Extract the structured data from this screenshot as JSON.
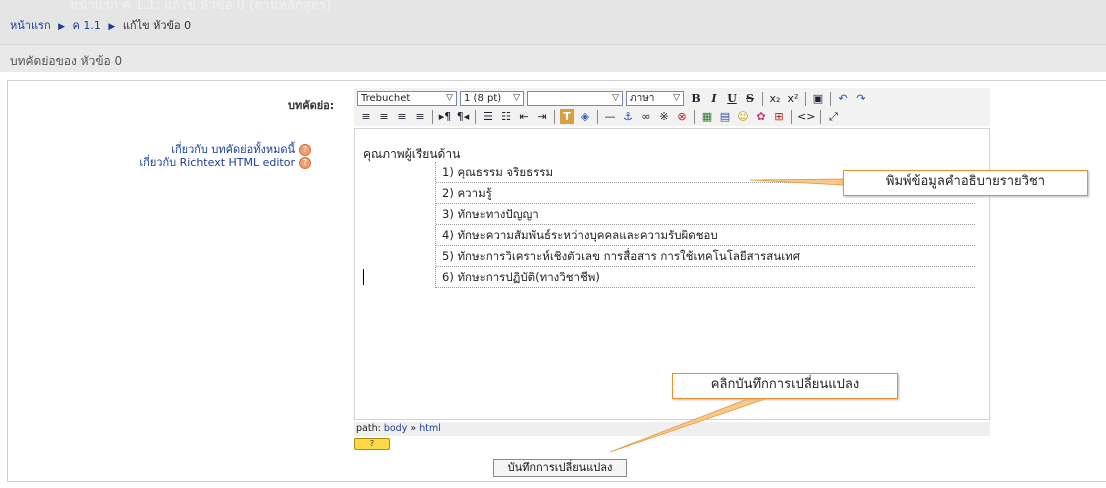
{
  "header": {
    "faded_title": "หน้าแรก ค 1.1: แก้ไข หัวข้อ 0 (ตามหลักสูตร)",
    "breadcrumb": {
      "home": "หน้าแรก",
      "course": "ค 1.1",
      "current": "แก้ไข หัวข้อ 0",
      "separator": "▶"
    }
  },
  "section_heading": "บทคัดย่อของ หัวข้อ 0",
  "form": {
    "summary_label": "บทคัดย่อ:",
    "help_links": {
      "about_summary": "เกี่ยวกับ บทคัดย่อทั้งหมดนี้",
      "about_editor": "เกี่ยวกับ Richtext HTML editor"
    },
    "save_button": "บันทึกการเปลี่ยนแปลง"
  },
  "editor": {
    "font_family": "Trebuchet",
    "font_size": "1 (8 pt)",
    "paragraph_style": "",
    "language": "ภาษา",
    "toolbar_row1": [
      "B",
      "I",
      "U",
      "S",
      "x₂",
      "x²",
      "▣",
      "↶",
      "↷"
    ],
    "toolbar_row2": [
      "≡",
      "≡",
      "≡",
      "≡",
      "▸¶",
      "¶◂",
      "☰",
      "☷",
      "⇤",
      "⇥",
      "T",
      "◈",
      "—",
      "⚓",
      "∞",
      "※",
      "⊗",
      "▦",
      "▤",
      "☺",
      "✿",
      "⊞",
      "<>",
      "⤢"
    ],
    "content": {
      "intro": "คุณภาพผู้เรียนด้าน",
      "items": [
        "1) คุณธรรม  จริยธรรม",
        "2) ความรู้",
        "3) ทักษะทางปัญญา",
        "4) ทักษะความสัมพันธ์ระหว่างบุคคลและความรับผิดชอบ",
        "5) ทักษะการวิเคราะห์เชิงตัวเลข  การสื่อสาร การใช้เทคโนโลยีสารสนเทศ",
        "6) ทักษะการปฏิบัติ(ทางวิชาชีพ)"
      ]
    },
    "path_label": "path:",
    "path_items": [
      "body",
      "html"
    ],
    "path_sep": "»",
    "help_badge": "?"
  },
  "callouts": {
    "description_hint": "พิมพ์ข้อมูลคำอธิบายรายวิชา",
    "save_hint": "คลิกบันทึกการเปลี่ยนแปลง"
  },
  "colors": {
    "link": "#1a3d9e",
    "callout_border": "#e89030",
    "help_badge": "#ffd84a"
  }
}
